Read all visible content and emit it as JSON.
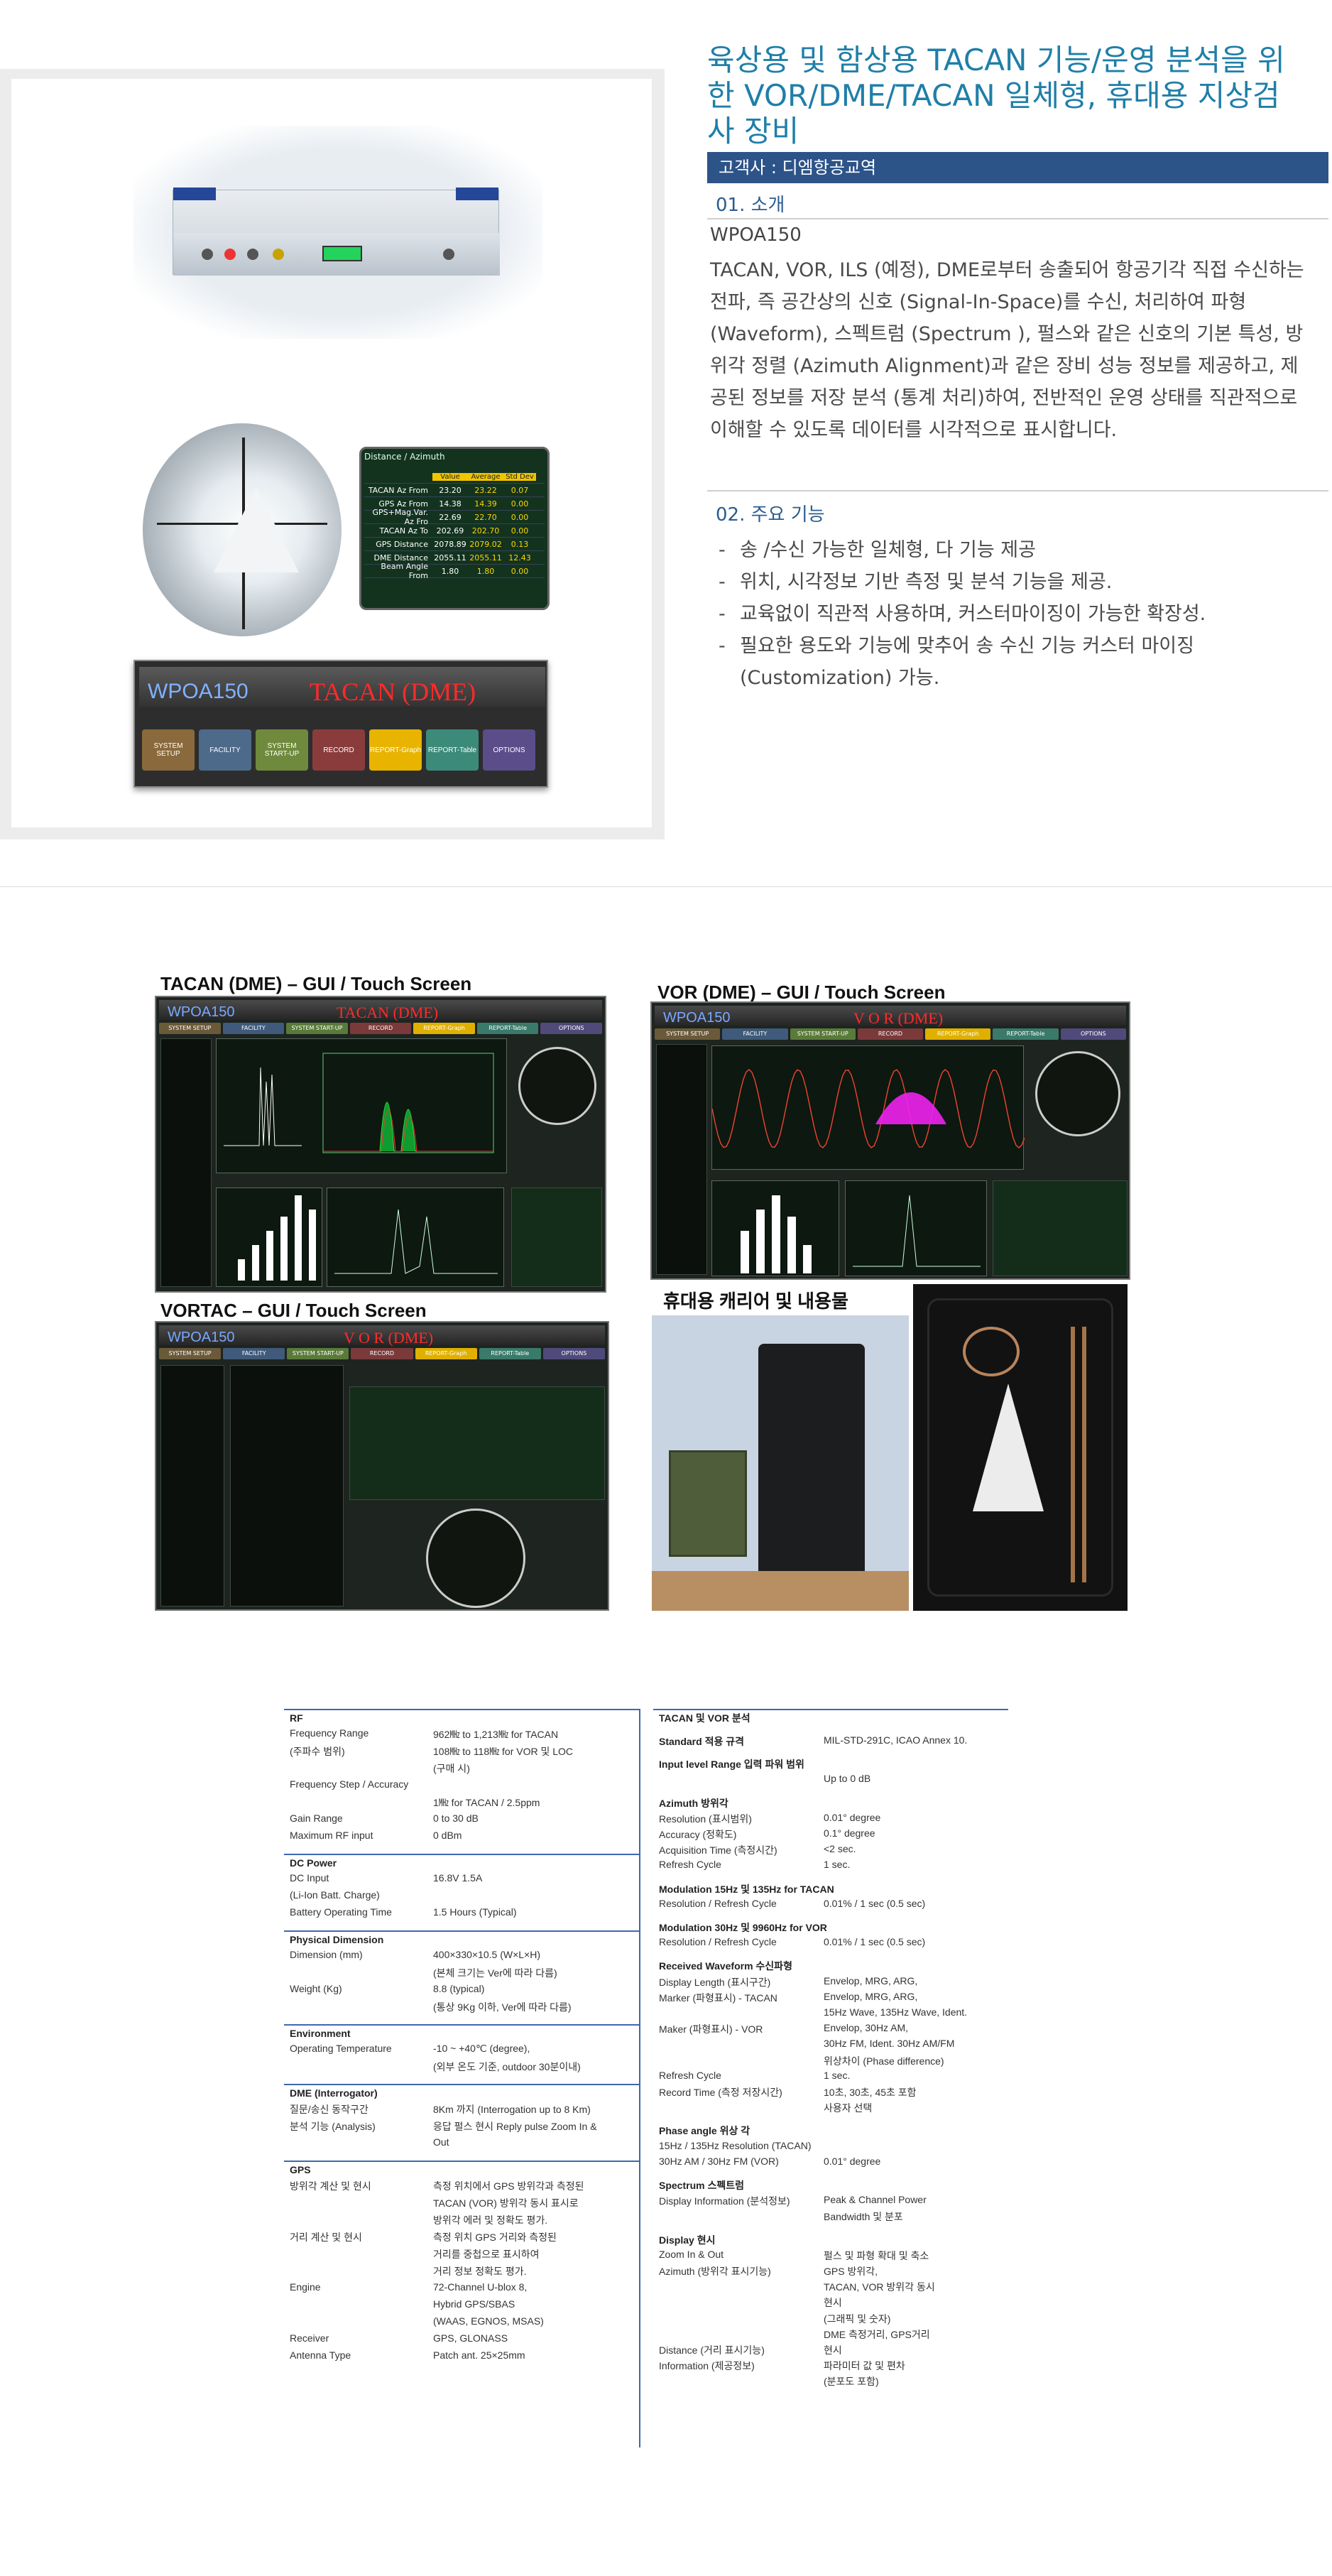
{
  "product": {
    "title": "육상용 및 함상용 TACAN 기능/운영 분석을 위한 VOR/DME/TACAN 일체형, 휴대용 지상검사 장비",
    "client": "고객사 : 디엠항공교역",
    "section1": "01. 소개",
    "model": "WPOA150",
    "description": "TACAN, VOR, ILS (예정), DME로부터 송출되어 항공기각 직접 수신하는 전파, 즉 공간상의 신호 (Signal-In-Space)를 수신, 처리하여 파형 (Waveform), 스펙트럼 (Spectrum ), 펄스와 같은 신호의 기본 특성, 방위각 정렬 (Azimuth Alignment)과 같은 장비 성능 정보를 제공하고, 제공된 정보를 저장 분석 (통계 처리)하여, 전반적인 운영 상태를 직관적으로 이해할 수 있도록 데이터를 시각적으로 표시합니다.",
    "section2": "02. 주요 기능",
    "features": [
      "송 /수신 가능한 일체형, 다 기능 제공",
      "위치, 시각정보 기반 측정 및 분석 기능을 제공.",
      "교육없이 직관적 사용하며, 커스터마이징이 가능한 확장성.",
      "필요한 용도와 기능에 맞추어 송 수신 기능 커스터 마이징 (Customization) 가능."
    ]
  },
  "azimuth_table": {
    "title": "Distance / Azimuth",
    "headers": [
      "",
      "Value",
      "Average",
      "Std Dev"
    ],
    "rows": [
      [
        "TACAN Az From",
        "23.20",
        "23.22",
        "0.07"
      ],
      [
        "GPS Az From",
        "14.38",
        "14.39",
        "0.00"
      ],
      [
        "GPS+Mag.Var. Az Fro",
        "22.69",
        "22.70",
        "0.00"
      ],
      [
        "TACAN Az To",
        "202.69",
        "202.70",
        "0.00"
      ],
      [
        "GPS Distance",
        "2078.89",
        "2079.02",
        "0.13"
      ],
      [
        "DME Distance",
        "2055.11",
        "2055.11",
        "12.43"
      ],
      [
        "Beam Angle From",
        "1.80",
        "1.80",
        "0.00"
      ]
    ]
  },
  "device_ui": {
    "name": "WPOA150",
    "mode": "TACAN (DME)",
    "buttons": [
      {
        "label": "SYSTEM SETUP",
        "color": "#8a6a3c"
      },
      {
        "label": "FACILITY",
        "color": "#4d6a8a"
      },
      {
        "label": "SYSTEM START-UP",
        "color": "#6f8a3c"
      },
      {
        "label": "RECORD",
        "color": "#8a3c3c"
      },
      {
        "label": "REPORT-Graph",
        "color": "#e8b400"
      },
      {
        "label": "REPORT-Table",
        "color": "#3c8a7a"
      },
      {
        "label": "OPTIONS",
        "color": "#5a4d8a"
      }
    ]
  },
  "screens": {
    "tacan_label": "TACAN (DME) – GUI / Touch Screen",
    "vor_label": "VOR (DME) – GUI / Touch Screen",
    "vortac_label": "VORTAC – GUI / Touch Screen",
    "carrier_label": "휴대용 캐리어 및 내용물",
    "gui_name": "WPOA150",
    "tacan_mode": "TACAN (DME)",
    "vor_mode": "V O R (DME)",
    "tabs": [
      "SYSTEM SETUP",
      "FACILITY",
      "SYSTEM START-UP",
      "RECORD",
      "REPORT-Graph",
      "REPORT-Table",
      "OPTIONS"
    ]
  },
  "spec_left": [
    {
      "type": "hdr",
      "text": "RF"
    },
    {
      "type": "row",
      "k": "Frequency Range",
      "v": "962㎒ to 1,213㎒ for TACAN"
    },
    {
      "type": "row",
      "k": "(주파수 범위)",
      "v": "108㎒ to 118㎒ for VOR 및 LOC"
    },
    {
      "type": "row",
      "k": "",
      "v": "(구매 시)"
    },
    {
      "type": "row",
      "k": "Frequency Step / Accuracy",
      "v": ""
    },
    {
      "type": "row",
      "k": "",
      "v": "1㎒ for TACAN / 2.5ppm"
    },
    {
      "type": "row",
      "k": "Gain Range",
      "v": "0 to 30 dB"
    },
    {
      "type": "row",
      "k": "Maximum RF input",
      "v": "0 dBm"
    },
    {
      "type": "hdr",
      "text": "DC Power"
    },
    {
      "type": "row",
      "k": "DC Input",
      "v": "16.8V 1.5A"
    },
    {
      "type": "row",
      "k": "(Li-Ion Batt. Charge)",
      "v": ""
    },
    {
      "type": "row",
      "k": "Battery Operating Time",
      "v": "1.5 Hours (Typical)"
    },
    {
      "type": "hdr",
      "text": "Physical Dimension"
    },
    {
      "type": "row",
      "k": "Dimension (mm)",
      "v": "400×330×10.5 (W×L×H)"
    },
    {
      "type": "row",
      "k": "",
      "v": "(본체 크기는 Ver에 따라 다름)"
    },
    {
      "type": "row",
      "k": "Weight (Kg)",
      "v": "8.8 (typical)"
    },
    {
      "type": "row",
      "k": "",
      "v": "(통상 9Kg 이하, Ver에 따라 다름)"
    },
    {
      "type": "hdr",
      "text": "Environment"
    },
    {
      "type": "row",
      "k": "Operating Temperature",
      "v": "-10 ~ +40℃ (degree),"
    },
    {
      "type": "row",
      "k": "",
      "v": "(외부 온도 기준, outdoor 30분이내)"
    },
    {
      "type": "hdr",
      "text": "DME (Interrogator)"
    },
    {
      "type": "row",
      "k": "질문/송신 동작구간",
      "v": "8Km 까지 (Interrogation up to 8 Km)"
    },
    {
      "type": "row",
      "k": "분석 기능 (Analysis)",
      "v": "응답 펄스 현시 Reply pulse Zoom In &"
    },
    {
      "type": "row",
      "k": "",
      "v": "Out"
    },
    {
      "type": "hdr",
      "text": "GPS"
    },
    {
      "type": "row",
      "k": "방위각 계산 및 현시",
      "v": "측정 위치에서 GPS 방위각과 측정된"
    },
    {
      "type": "row",
      "k": "",
      "v": "TACAN (VOR) 방위각 동시 표시로"
    },
    {
      "type": "row",
      "k": "",
      "v": "방위각 에러 및 정확도 평가."
    },
    {
      "type": "row",
      "k": "거리 계산 및 현시",
      "v": "측정 위치 GPS 거리와 측정된"
    },
    {
      "type": "row",
      "k": "",
      "v": "거리를 중첩으로 표시하여"
    },
    {
      "type": "row",
      "k": "",
      "v": "거리 정보 정확도 평가."
    },
    {
      "type": "row",
      "k": "Engine",
      "v": "72-Channel U-blox 8,"
    },
    {
      "type": "row",
      "k": "",
      "v": "Hybrid GPS/SBAS"
    },
    {
      "type": "row",
      "k": "",
      "v": "(WAAS, EGNOS, MSAS)"
    },
    {
      "type": "row",
      "k": "Receiver",
      "v": "GPS, GLONASS"
    },
    {
      "type": "row",
      "k": "Antenna Type",
      "v": "Patch ant. 25×25mm"
    }
  ],
  "spec_right": [
    {
      "type": "hdr",
      "text": "TACAN 및 VOR 분석"
    },
    {
      "type": "sub",
      "k": "Standard 적용 규격",
      "v": "MIL-STD-291C, ICAO Annex 10."
    },
    {
      "type": "sub",
      "k": "Input level Range 입력 파워 범위",
      "v": ""
    },
    {
      "type": "row",
      "k": "",
      "v": "Up to 0 dB"
    },
    {
      "type": "sub",
      "k": "Azimuth 방위각",
      "v": ""
    },
    {
      "type": "row",
      "k": "Resolution (표시범위)",
      "v": "0.01° degree"
    },
    {
      "type": "row",
      "k": "Accuracy (정확도)",
      "v": "0.1° degree"
    },
    {
      "type": "row",
      "k": "Acquisition Time (측정시간)",
      "v": "<2 sec."
    },
    {
      "type": "row",
      "k": "Refresh Cycle",
      "v": "1 sec."
    },
    {
      "type": "sub",
      "k": "Modulation 15Hz 및 135Hz for TACAN",
      "v": ""
    },
    {
      "type": "row",
      "k": "Resolution / Refresh Cycle",
      "v": "0.01% / 1 sec (0.5 sec)"
    },
    {
      "type": "sub",
      "k": "Modulation 30Hz 및 9960Hz for VOR",
      "v": ""
    },
    {
      "type": "row",
      "k": "Resolution / Refresh Cycle",
      "v": "0.01% / 1 sec (0.5 sec)"
    },
    {
      "type": "sub",
      "k": "Received Waveform 수신파형",
      "v": ""
    },
    {
      "type": "row",
      "k": "Display Length (표시구간)",
      "v": "Envelop, MRG, ARG,"
    },
    {
      "type": "row",
      "k": "Marker (파형표시) - TACAN",
      "v": "Envelop, MRG, ARG,"
    },
    {
      "type": "row",
      "k": "",
      "v": "15Hz Wave, 135Hz Wave, Ident."
    },
    {
      "type": "row",
      "k": "Maker (파형표시) - VOR",
      "v": "Envelop, 30Hz AM,"
    },
    {
      "type": "row",
      "k": "",
      "v": "30Hz FM, Ident. 30Hz AM/FM"
    },
    {
      "type": "row",
      "k": "",
      "v": "위상차이 (Phase difference)"
    },
    {
      "type": "row",
      "k": "Refresh Cycle",
      "v": "1 sec."
    },
    {
      "type": "row",
      "k": "Record Time (측정 저장시간)",
      "v": "10초, 30초, 45초 포함"
    },
    {
      "type": "row",
      "k": "",
      "v": "사용자 선택"
    },
    {
      "type": "sub",
      "k": "Phase angle 위상 각",
      "v": ""
    },
    {
      "type": "row",
      "k": "15Hz / 135Hz Resolution (TACAN)",
      "v": ""
    },
    {
      "type": "row",
      "k": "30Hz AM / 30Hz FM (VOR)",
      "v": "0.01° degree"
    },
    {
      "type": "sub",
      "k": "Spectrum 스펙트럼",
      "v": ""
    },
    {
      "type": "row",
      "k": "Display Information (분석정보)",
      "v": "Peak & Channel Power"
    },
    {
      "type": "row",
      "k": "",
      "v": "Bandwidth 및 분포"
    },
    {
      "type": "sub",
      "k": "Display 현시",
      "v": ""
    },
    {
      "type": "row",
      "k": "Zoom In & Out",
      "v": "펄스 및 파형 확대 및 축소"
    },
    {
      "type": "row",
      "k": "Azimuth (방위각 표시기능)",
      "v": "GPS 방위각,"
    },
    {
      "type": "row",
      "k": "",
      "v": "TACAN, VOR 방위각 동시"
    },
    {
      "type": "row",
      "k": "",
      "v": "현시"
    },
    {
      "type": "row",
      "k": "",
      "v": "(그래픽 및 숫자)"
    },
    {
      "type": "row",
      "k": "",
      "v": "DME 측정거리, GPS거리"
    },
    {
      "type": "row",
      "k": "Distance (거리 표시기능)",
      "v": "현시"
    },
    {
      "type": "row",
      "k": "Information (제공정보)",
      "v": "파라미터 값 및 편차"
    },
    {
      "type": "row",
      "k": "",
      "v": "(분포도 포함)"
    }
  ]
}
